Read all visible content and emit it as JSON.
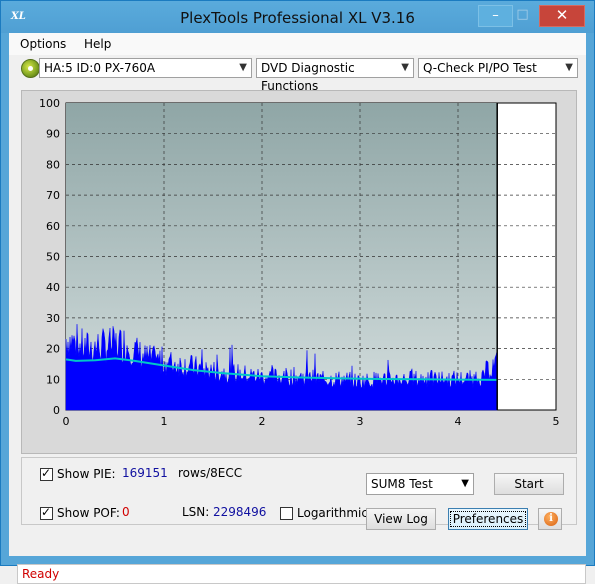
{
  "window": {
    "title": "PlexTools Professional XL V3.16",
    "app_icon_text": "XL"
  },
  "menu": {
    "options": "Options",
    "help": "Help"
  },
  "toolbar": {
    "drive": "HA:5 ID:0  PX-760A",
    "function": "DVD Diagnostic Functions",
    "test": "Q-Check PI/PO Test"
  },
  "controls": {
    "show_pie_label": "Show PIE:",
    "pie_value": "169151",
    "pie_unit": "rows/8ECC",
    "show_pof_label": "Show POF:",
    "pof_value": "0",
    "lsn_label": "LSN:",
    "lsn_value": "2298496",
    "logarithmic_label": "Logarithmic",
    "sum_select": "SUM8 Test",
    "start_label": "Start",
    "view_log_label": "View Log",
    "preferences_label": "Preferences"
  },
  "status": {
    "text": "Ready"
  },
  "colors": {
    "pie_fill": "#0000ff",
    "avg_line": "#00c8c8",
    "plot_bg": "#a9bcbc"
  },
  "chart_data": {
    "type": "area",
    "xlim": [
      0,
      5
    ],
    "ylim": [
      0,
      100
    ],
    "x_ticks": [
      "0",
      "1",
      "2",
      "3",
      "4",
      "5"
    ],
    "y_ticks": [
      "0",
      "10",
      "20",
      "30",
      "40",
      "50",
      "60",
      "70",
      "80",
      "90",
      "100"
    ],
    "grid": true,
    "end_marker_x": 4.4,
    "series": [
      {
        "x": [
          0.0,
          0.2,
          0.4,
          0.6,
          0.8,
          1.0,
          1.2,
          1.4,
          1.6,
          1.8,
          2.0,
          2.2,
          2.4,
          2.6,
          2.8,
          3.0,
          3.2,
          3.4,
          3.6,
          3.8,
          4.0,
          4.2,
          4.4
        ],
        "y": [
          30,
          26,
          27,
          28,
          22,
          20,
          19,
          17,
          16,
          15,
          14,
          14,
          14,
          13,
          13,
          12,
          13,
          13,
          13,
          13,
          13,
          13,
          20
        ]
      },
      {
        "x": [
          0.0,
          0.1,
          0.3,
          0.5,
          0.7,
          1.0,
          1.3,
          1.6,
          2.0,
          2.4,
          2.8,
          3.2,
          3.6,
          4.0,
          4.4
        ],
        "y": [
          16.5,
          16.0,
          16.2,
          16.8,
          16.0,
          14.5,
          13.0,
          12.0,
          11.0,
          10.6,
          10.3,
          10.1,
          10.0,
          9.9,
          9.8
        ]
      }
    ]
  }
}
